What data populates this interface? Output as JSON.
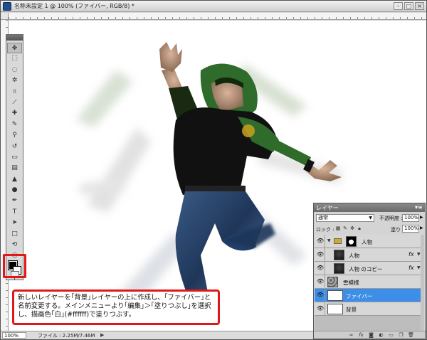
{
  "window": {
    "title": "名称未設定 1 @ 100% (ファイバー, RGB/8) *",
    "minimize": "–",
    "maximize": "□",
    "close": "×"
  },
  "status": {
    "zoom": "100%",
    "file_info": "ファイル : 2.25M/7.46M",
    "arrow": "▶"
  },
  "tools": [
    {
      "icon": "move-icon",
      "glyph": "✥"
    },
    {
      "icon": "marquee-icon",
      "glyph": "⬚"
    },
    {
      "icon": "lasso-icon",
      "glyph": "◌"
    },
    {
      "icon": "magic-wand-icon",
      "glyph": "✲"
    },
    {
      "icon": "crop-icon",
      "glyph": "⌗"
    },
    {
      "icon": "eyedropper-icon",
      "glyph": "⟋"
    },
    {
      "icon": "healing-brush-icon",
      "glyph": "✚"
    },
    {
      "icon": "brush-icon",
      "glyph": "✎"
    },
    {
      "icon": "clone-stamp-icon",
      "glyph": "⚲"
    },
    {
      "icon": "history-brush-icon",
      "glyph": "↺"
    },
    {
      "icon": "eraser-icon",
      "glyph": "▭"
    },
    {
      "icon": "gradient-icon",
      "glyph": "▤"
    },
    {
      "icon": "blur-icon",
      "glyph": "▲"
    },
    {
      "icon": "dodge-icon",
      "glyph": "●"
    },
    {
      "icon": "pen-icon",
      "glyph": "✒"
    },
    {
      "icon": "type-icon",
      "glyph": "T"
    },
    {
      "icon": "path-selection-icon",
      "glyph": "➤"
    },
    {
      "icon": "shape-icon",
      "glyph": "□"
    },
    {
      "icon": "3d-rotate-icon",
      "glyph": "⟲"
    },
    {
      "icon": "3d-orbit-icon",
      "glyph": "◎"
    },
    {
      "icon": "hand-icon",
      "glyph": "✋"
    },
    {
      "icon": "zoom-icon",
      "glyph": "⚲"
    }
  ],
  "caption": "新しいレイヤーを｢背景｣レイヤーの上に作成し、｢ファイバー｣と\n名前変更する。メインメニューより｢編集｣＞｢塗りつぶし｣を選択\nし、描画色｢白｣(#ffffff)で塗りつぶす。",
  "layers_panel": {
    "tab": "レイヤー",
    "menu": "▾≡",
    "blend_mode": "通常",
    "opacity_label": "不透明度 :",
    "opacity_value": "100%",
    "lock_label": "ロック :",
    "fill_label": "塗り :",
    "fill_value": "100%",
    "layers": [
      {
        "name": "人物",
        "type": "group"
      },
      {
        "name": "人物",
        "type": "layer",
        "fx": "fx"
      },
      {
        "name": "人物 のコピー",
        "type": "layer",
        "fx": "fx"
      },
      {
        "name": "雲模様",
        "type": "layer"
      },
      {
        "name": "ファイバー",
        "type": "layer",
        "active": true
      },
      {
        "name": "背景",
        "type": "layer"
      }
    ],
    "footer_icons": [
      "link-icon",
      "fx-icon",
      "mask-icon",
      "adjustment-icon",
      "folder-icon",
      "new-layer-icon",
      "trash-icon"
    ]
  },
  "colors": {
    "accent_red": "#e01818",
    "selection_blue": "#3d8ee8",
    "hoodie_green": "#2f6b2a"
  }
}
